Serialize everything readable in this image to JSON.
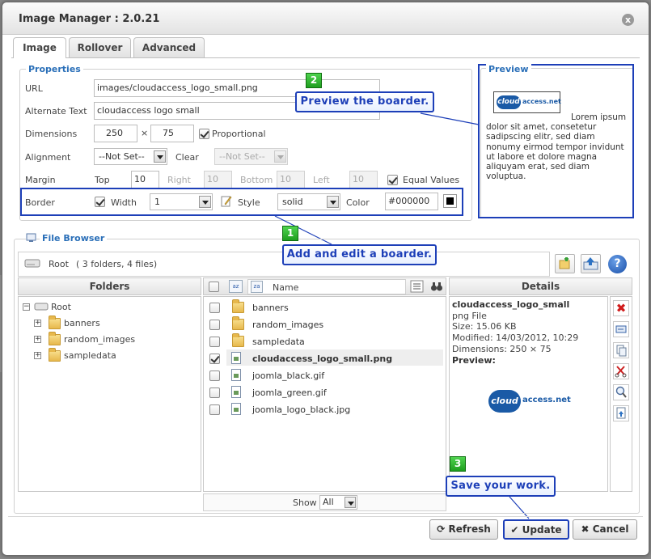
{
  "dialog": {
    "title": "Image Manager : 2.0.21",
    "close_label": "x"
  },
  "tabs": [
    {
      "label": "Image"
    },
    {
      "label": "Rollover"
    },
    {
      "label": "Advanced"
    }
  ],
  "properties": {
    "legend": "Properties",
    "url_label": "URL",
    "url_value": "images/cloudaccess_logo_small.png",
    "alt_label": "Alternate Text",
    "alt_value": "cloudaccess logo small",
    "dimensions_label": "Dimensions",
    "width_value": "250",
    "times": "×",
    "height_value": "75",
    "proportional_label": "Proportional",
    "alignment_label": "Alignment",
    "alignment_value": "--Not Set--",
    "clear_label": "Clear",
    "clear_value": "--Not Set--",
    "margin_label": "Margin",
    "top_label": "Top",
    "top_value": "10",
    "right_label": "Right",
    "right_value": "10",
    "bottom_label": "Bottom",
    "bottom_value": "10",
    "left_label": "Left",
    "left_value": "10",
    "equal_values_label": "Equal Values",
    "border_label": "Border",
    "width_label": "Width",
    "border_width_value": "1",
    "style_label": "Style",
    "style_value": "solid",
    "color_label": "Color",
    "color_value": "#000000"
  },
  "preview": {
    "legend": "Preview",
    "lorem": "Lorem ipsum dolor sit amet, consetetur sadipscing elitr, sed diam nonumy eirmod tempor invidunt ut labore et dolore magna aliquyam erat, sed diam voluptua."
  },
  "logo": {
    "cloud": "cloud",
    "rest": "access.net"
  },
  "file_browser": {
    "legend": "File Browser",
    "root_info_name": "Root",
    "root_info_count": "( 3 folders, 4 files)",
    "folders_header": "Folders",
    "name_header": "Name",
    "details_header": "Details",
    "tree_root": "Root",
    "tree_folders": [
      "banners",
      "random_images",
      "sampledata"
    ],
    "files": [
      {
        "name": "banners",
        "kind": "folder"
      },
      {
        "name": "random_images",
        "kind": "folder"
      },
      {
        "name": "sampledata",
        "kind": "folder"
      },
      {
        "name": "cloudaccess_logo_small.png",
        "kind": "file"
      },
      {
        "name": "joomla_black.gif",
        "kind": "file"
      },
      {
        "name": "joomla_green.gif",
        "kind": "file"
      },
      {
        "name": "joomla_logo_black.jpg",
        "kind": "file"
      }
    ],
    "show_label": "Show",
    "show_value": "All"
  },
  "details": {
    "filename": "cloudaccess_logo_small",
    "type": "png File",
    "size": "Size: 15.06 KB",
    "modified": "Modified: 14/03/2012, 10:29",
    "dimensions": "Dimensions: 250 × 75",
    "preview_label": "Preview:"
  },
  "callouts": [
    {
      "badge": "1",
      "text": "Add and edit a boarder."
    },
    {
      "badge": "2",
      "text": "Preview the boarder."
    },
    {
      "badge": "3",
      "text": "Save your work."
    }
  ],
  "buttons": {
    "refresh": "Refresh",
    "update": "Update",
    "cancel": "Cancel"
  },
  "colors": {
    "accent": "#1d3fb8",
    "legend": "#2a6fb8",
    "badge": "#2fb52f",
    "logo": "#1a5aa6"
  }
}
